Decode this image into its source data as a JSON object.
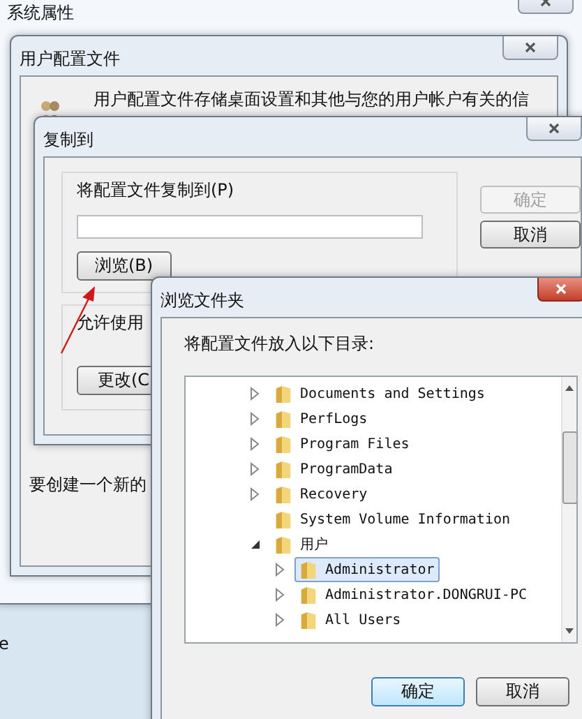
{
  "system_properties": {
    "title": "系统属性",
    "edge_text": "e"
  },
  "profiles_window": {
    "title": "用户配置文件",
    "description": "用户配置文件存储桌面设置和其他与您的用户帐户有关的信",
    "create_text": "要创建一个新的"
  },
  "copy_to_dialog": {
    "title": "复制到",
    "group_label": "将配置文件复制到(P)",
    "browse_button": "浏览(B)",
    "permit_label": "允许使用",
    "change_button": "更改(C",
    "buttons": [
      {
        "label": "确定",
        "disabled": true
      },
      {
        "label": "取消",
        "disabled": false
      }
    ]
  },
  "browse_folder_dialog": {
    "title": "浏览文件夹",
    "prompt": "将配置文件放入以下目录:",
    "tree": [
      {
        "label": "Documents and Settings",
        "has_children": true,
        "expanded": false,
        "selected": false
      },
      {
        "label": "PerfLogs",
        "has_children": true,
        "expanded": false,
        "selected": false
      },
      {
        "label": "Program Files",
        "has_children": true,
        "expanded": false,
        "selected": false
      },
      {
        "label": "ProgramData",
        "has_children": true,
        "expanded": false,
        "selected": false
      },
      {
        "label": "Recovery",
        "has_children": true,
        "expanded": false,
        "selected": false
      },
      {
        "label": "System Volume Information",
        "has_children": false,
        "selected": false
      },
      {
        "label": "用户",
        "has_children": true,
        "expanded": true,
        "selected": false,
        "children": [
          {
            "label": "Administrator",
            "has_children": true,
            "expanded": false,
            "selected": true
          },
          {
            "label": "Administrator.DONGRUI-PC",
            "has_children": true,
            "expanded": false,
            "selected": false
          },
          {
            "label": "All Users",
            "has_children": true,
            "expanded": false,
            "selected": false
          }
        ]
      }
    ],
    "buttons": [
      {
        "label": "确定",
        "focused": true
      },
      {
        "label": "取消",
        "focused": false
      }
    ]
  }
}
